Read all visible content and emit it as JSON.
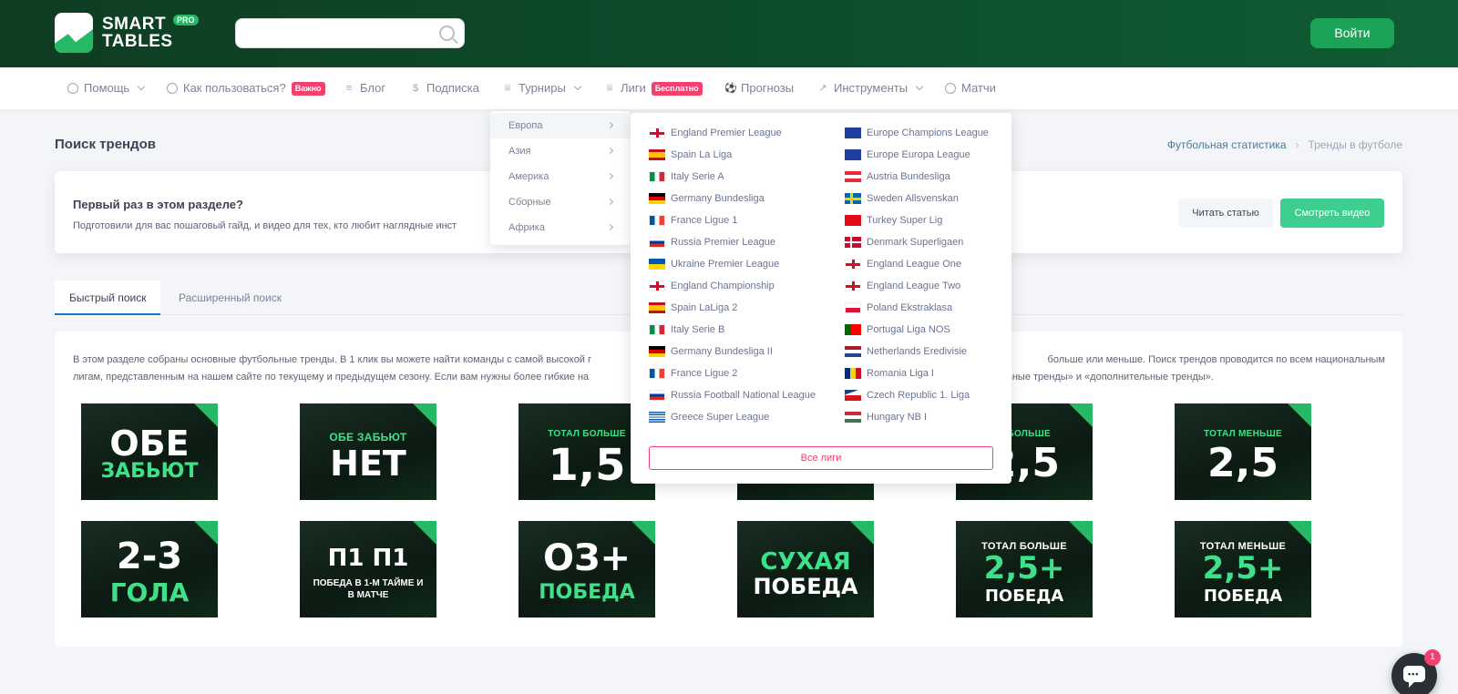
{
  "header": {
    "logo_line1": "SMART",
    "logo_line2": "TABLES",
    "logo_badge": "PRO",
    "search_placeholder": "",
    "login_label": "Войти"
  },
  "nav": {
    "items": [
      {
        "label": "Помощь",
        "icon": "help-circle-icon"
      },
      {
        "label": "Как пользоваться?",
        "badge": "Важно",
        "icon": "help-circle-icon"
      },
      {
        "label": "Блог",
        "icon": "lines-icon"
      },
      {
        "label": "Подписка",
        "icon": "dollar-icon"
      },
      {
        "label": "Турниры",
        "icon": "trophy-icon"
      },
      {
        "label": "Лиги",
        "badge": "Бесплатно",
        "icon": "trophy-icon"
      },
      {
        "label": "Прогнозы",
        "icon": "ball-icon"
      },
      {
        "label": "Инструменты",
        "icon": "chart-icon"
      },
      {
        "label": "Матчи",
        "icon": "clock-icon"
      }
    ]
  },
  "page": {
    "title": "Поиск трендов",
    "breadcrumb": [
      "Футбольная статистика",
      "Тренды в футболе"
    ]
  },
  "info": {
    "title": "Первый раз в этом разделе?",
    "text": "Подготовили для вас пошаговый гайд, и видео для тех, кто любит наглядные инст",
    "read_label": "Читать статью",
    "video_label": "Смотреть видео"
  },
  "tabs": [
    "Быстрый поиск",
    "Расширенный поиск"
  ],
  "content": {
    "line1_a": "В этом разделе собраны основные футбольные тренды. В 1 клик вы можете найти команды с самой высокой г",
    "line1_b": "больше или меньше. Поиск трендов проводится по всем национальным",
    "line2_a": "лигам, представленным на нашем сайте по текущему и предыдущем сезону. Если вам нужны более гибкие на",
    "line2_b": "больные тренды» и «дополнительные тренды».",
    "tiles": [
      {
        "top": "",
        "big": "ОБЕ",
        "bottom": "ЗАБЬЮТ"
      },
      {
        "top": "ОБЕ ЗАБЬЮТ",
        "big": "НЕТ",
        "bottom": ""
      },
      {
        "top": "ТОТАЛ БОЛЬШЕ",
        "big": "1,5",
        "bottom": ""
      },
      {
        "top": "",
        "big": "",
        "bottom": ""
      },
      {
        "top": "Л БОЛЬШЕ",
        "big": "2,5",
        "bottom": ""
      },
      {
        "top": "ТОТАЛ МЕНЬШЕ",
        "big": "2,5",
        "bottom": ""
      },
      {
        "top": "",
        "big": "2-3",
        "bottom": "ГОЛА"
      },
      {
        "top": "",
        "big": "П1 П1",
        "bottom": "ПОБЕДА В 1-М ТАЙМЕ И В МАТЧЕ"
      },
      {
        "top": "",
        "big": "ОЗ+",
        "bottom": "ПОБЕДА"
      },
      {
        "top": "",
        "big": "СУХАЯ",
        "bottom": "ПОБЕДА"
      },
      {
        "top": "ТОТАЛ БОЛЬШЕ",
        "big": "2,5+",
        "bottom": "ПОБЕДА"
      },
      {
        "top": "ТОТАЛ МЕНЬШЕ",
        "big": "2,5+",
        "bottom": "ПОБЕДА"
      }
    ]
  },
  "regions": [
    "Европа",
    "Азия",
    "Америка",
    "Сборные",
    "Африка"
  ],
  "leagues": {
    "left": [
      {
        "name": "England Premier League",
        "flag": "england"
      },
      {
        "name": "Spain La Liga",
        "flag": "spain"
      },
      {
        "name": "Italy Serie A",
        "flag": "italy"
      },
      {
        "name": "Germany Bundesliga",
        "flag": "germany"
      },
      {
        "name": "France Ligue 1",
        "flag": "france"
      },
      {
        "name": "Russia Premier League",
        "flag": "russia"
      },
      {
        "name": "Ukraine Premier League",
        "flag": "ukraine"
      },
      {
        "name": "England Championship",
        "flag": "england"
      },
      {
        "name": "Spain LaLiga 2",
        "flag": "spain"
      },
      {
        "name": "Italy Serie B",
        "flag": "italy"
      },
      {
        "name": "Germany Bundesliga II",
        "flag": "germany"
      },
      {
        "name": "France Ligue 2",
        "flag": "france"
      },
      {
        "name": "Russia Football National League",
        "flag": "russia"
      },
      {
        "name": "Greece Super League",
        "flag": "greece"
      }
    ],
    "right": [
      {
        "name": "Europe Champions League",
        "flag": "eu"
      },
      {
        "name": "Europe Europa League",
        "flag": "eu"
      },
      {
        "name": "Austria Bundesliga",
        "flag": "austria"
      },
      {
        "name": "Sweden Allsvenskan",
        "flag": "sweden"
      },
      {
        "name": "Turkey Super Lig",
        "flag": "turkey"
      },
      {
        "name": "Denmark Superligaen",
        "flag": "denmark"
      },
      {
        "name": "England League One",
        "flag": "england"
      },
      {
        "name": "England League Two",
        "flag": "england"
      },
      {
        "name": "Poland Ekstraklasa",
        "flag": "poland"
      },
      {
        "name": "Portugal Liga NOS",
        "flag": "portugal"
      },
      {
        "name": "Netherlands Eredivisie",
        "flag": "netherlands"
      },
      {
        "name": "Romania Liga I",
        "flag": "romania"
      },
      {
        "name": "Czech Republic 1. Liga",
        "flag": "czech"
      },
      {
        "name": "Hungary NB I",
        "flag": "hungary"
      }
    ],
    "all_label": "Все лиги"
  },
  "chat": {
    "count": "1"
  },
  "colors": {
    "brand_green": "#1da357",
    "accent_red": "#f1416c",
    "header_dark": "#0f3d22"
  }
}
